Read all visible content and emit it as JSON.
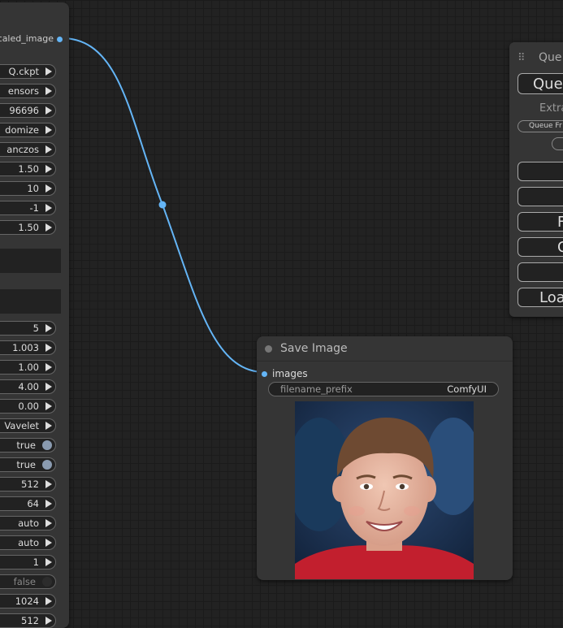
{
  "left_node": {
    "output_label": "caled_image",
    "widgets_top": [
      {
        "value": "Q.ckpt",
        "kind": "combo"
      },
      {
        "value": "ensors",
        "kind": "combo"
      },
      {
        "value": "96696",
        "kind": "number"
      },
      {
        "value": "domize",
        "kind": "combo"
      },
      {
        "value": "anczos",
        "kind": "combo"
      },
      {
        "value": "1.50",
        "kind": "number"
      },
      {
        "value": "10",
        "kind": "number"
      },
      {
        "value": "-1",
        "kind": "number"
      },
      {
        "value": "1.50",
        "kind": "number"
      }
    ],
    "widgets_bottom": [
      {
        "value": "5",
        "kind": "number"
      },
      {
        "value": "1.003",
        "kind": "number"
      },
      {
        "value": "1.00",
        "kind": "number"
      },
      {
        "value": "4.00",
        "kind": "number"
      },
      {
        "value": "0.00",
        "kind": "number"
      },
      {
        "value": "Vavelet",
        "kind": "combo"
      },
      {
        "value": "true",
        "kind": "toggle-on"
      },
      {
        "value": "true",
        "kind": "toggle-on"
      },
      {
        "value": "512",
        "kind": "number"
      },
      {
        "value": "64",
        "kind": "number"
      },
      {
        "value": "auto",
        "kind": "combo"
      },
      {
        "value": "auto",
        "kind": "combo"
      },
      {
        "value": "1",
        "kind": "number"
      },
      {
        "value": "false",
        "kind": "toggle-off"
      },
      {
        "value": "1024",
        "kind": "number"
      },
      {
        "value": "512",
        "kind": "number"
      }
    ]
  },
  "queue_panel": {
    "title": "Que",
    "queue_button": "Que",
    "extra_label": "Extra",
    "queue_front_label": "Queue Fr",
    "buttons": [
      "",
      "",
      "F",
      "Cl",
      "",
      "Loa"
    ]
  },
  "save_node": {
    "title": "Save Image",
    "input_label": "images",
    "field_label": "filename_prefix",
    "field_value": "ComfyUI"
  },
  "colors": {
    "link": "#64b5f6",
    "node_bg": "#353535",
    "canvas": "#222222"
  }
}
